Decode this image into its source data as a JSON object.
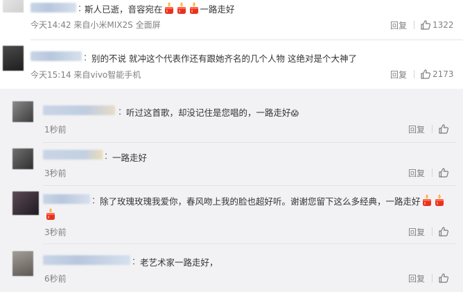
{
  "hot_comments": [
    {
      "text_before": "斯人已逝，音容宛在",
      "candles_after_text": 3,
      "text_after": "一路走好",
      "meta": "今天14:42 来自小米MIX2S 全面屏",
      "reply_label": "回复",
      "like_count": "1322"
    },
    {
      "text": "别的不说 就冲这个代表作还有跟她齐名的几个人物 这绝对是个大神了",
      "meta": "今天15:14 来自vivo智能手机",
      "reply_label": "回复",
      "like_count": "2173"
    }
  ],
  "new_comments": [
    {
      "text": "听过这首歌，却没记住是您唱的，一路走好",
      "emoji": "😱",
      "time": "1秒前",
      "reply_label": "回复"
    },
    {
      "text": "一路走好",
      "time": "3秒前",
      "reply_label": "回复"
    },
    {
      "text": "除了玫瑰玫瑰我爱你，春风吻上我的脸也超好听。谢谢您留下这么多经典，一路走好",
      "candles": 3,
      "time": "3秒前",
      "reply_label": "回复"
    },
    {
      "text": "老艺术家一路走好，",
      "time": "6秒前",
      "reply_label": "回复"
    }
  ],
  "colon": "：",
  "icons": {
    "like": "thumbs-up-icon",
    "candle": "candle-icon"
  },
  "colors": {
    "meta": "#808080",
    "background_new": "#f2f2f5",
    "candle_red": "#e8321e"
  }
}
